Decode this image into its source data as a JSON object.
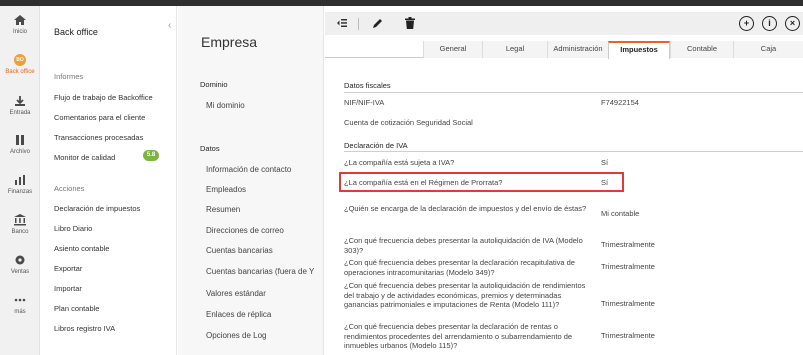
{
  "rail": [
    {
      "label": "Inicio",
      "icon": "home-icon"
    },
    {
      "label": "Back office",
      "icon": "back-office-icon",
      "badge": "BO"
    },
    {
      "label": "Entrada",
      "icon": "inbox-icon"
    },
    {
      "label": "Archivo",
      "icon": "archive-icon"
    },
    {
      "label": "Finanzas",
      "icon": "chart-icon"
    },
    {
      "label": "Banco",
      "icon": "bank-icon"
    },
    {
      "label": "Ventas",
      "icon": "sales-icon"
    },
    {
      "label": "más",
      "icon": "more-icon"
    }
  ],
  "menu": {
    "title": "Back office",
    "section_informes": "Informes",
    "informes": [
      "Flujo de trabajo de Backoffice",
      "Comentarios para el cliente",
      "Transacciones procesadas",
      "Monitor de calidad"
    ],
    "quality_badge": "5.8",
    "section_acciones": "Acciones",
    "acciones": [
      "Declaración de impuestos",
      "Libro Diario",
      "Asiento contable",
      "Exportar",
      "Importar",
      "Plan contable",
      "Libros registro IVA"
    ]
  },
  "col3": {
    "title": "Empresa",
    "section_dominio": "Dominio",
    "dominio_items": [
      "Mi dominio"
    ],
    "section_datos": "Datos",
    "datos_items": [
      "Información de contacto",
      "Empleados",
      "Resumen",
      "Direcciones de correo",
      "Cuentas bancarias",
      "Cuentas bancarias (fuera de Y",
      "Valores estándar",
      "Enlaces de réplica",
      "Opciones de Log"
    ]
  },
  "tabs": [
    "General",
    "Legal",
    "Administración",
    "Impuestos",
    "Contable",
    "Caja"
  ],
  "active_tab": "Impuestos",
  "fiscal": {
    "heading": "Datos fiscales",
    "nif_label": "NIF/NIF-IVA",
    "nif_value": "F74922154",
    "ss_label": "Cuenta de cotización Seguridad Social"
  },
  "iva": {
    "heading": "Declaración de IVA",
    "rows": [
      {
        "q": "¿La compañía está sujeta a IVA?",
        "a": "Sí"
      },
      {
        "q": "¿La compañía está en el Régimen de Prorrata?",
        "a": "Sí"
      },
      {
        "q": "¿Quién se encarga de la declaración de impuestos y del envío de éstas?",
        "a": "Mi contable"
      },
      {
        "q": "¿Con qué frecuencia debes presentar la autoliquidación de IVA (Modelo 303)?",
        "a": "Trimestralmente"
      },
      {
        "q": "¿Con qué frecuencia debes presentar la declaración recapitulativa de operaciones intracomunitarias (Modelo 349)?",
        "a": "Trimestralmente"
      },
      {
        "q": "¿Con qué frecuencia debes presentar la autoliquidación de rendimientos del trabajo y de actividades económicas, premios y determinadas ganancias patrimoniales e imputaciones de Renta (Modelo 111)?",
        "a": "Trimestralmente"
      },
      {
        "q": "¿Con qué frecuencia debes presentar la declaración de rentas o rendimientos procedentes del arrendamiento o subarrendamiento de inmuebles urbanos (Modelo 115)?",
        "a": "Trimestralmente"
      }
    ]
  },
  "colors": {
    "accent": "#e8641b",
    "badge": "#7cb342",
    "highlight": "#e53935"
  }
}
